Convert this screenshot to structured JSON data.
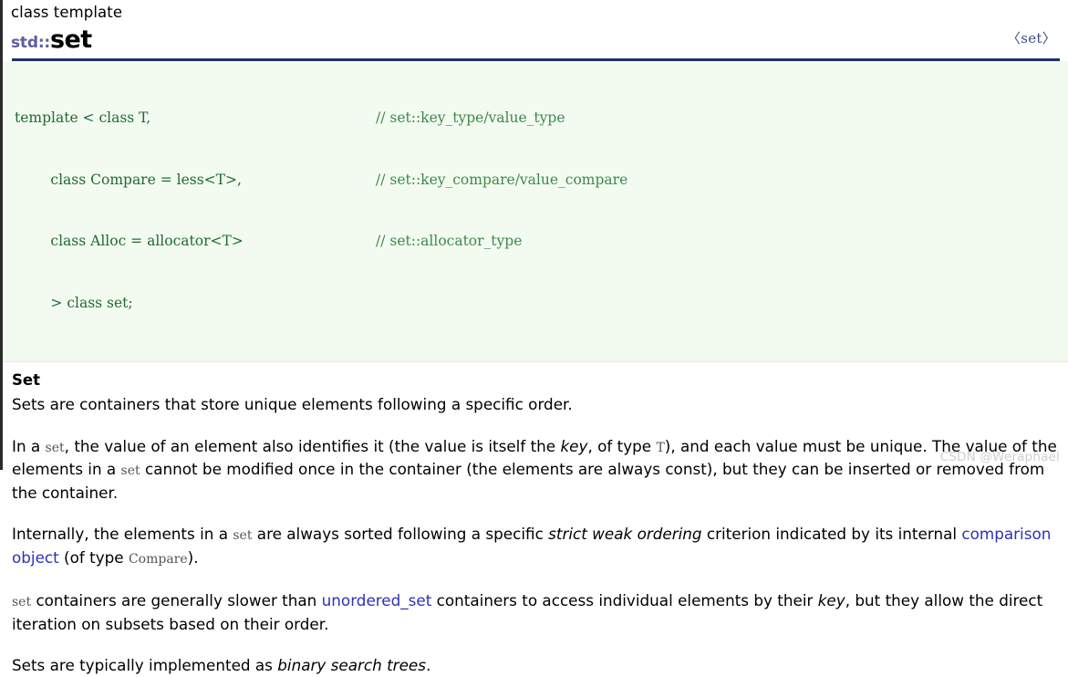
{
  "header": {
    "kind": "class template",
    "namespace": "std::",
    "name": "set",
    "header_file": "〈set〉"
  },
  "code_block": {
    "lines": [
      {
        "code": "template < class T,",
        "comment": "// set::key_type/value_type"
      },
      {
        "code": "        class Compare = less<T>,",
        "comment": "// set::key_compare/value_compare"
      },
      {
        "code": "        class Alloc = allocator<T>",
        "comment": "// set::allocator_type"
      },
      {
        "code": "        > class set;",
        "comment": ""
      }
    ]
  },
  "section": {
    "title": "Set",
    "paragraphs": {
      "p1": "Sets are containers that store unique elements following a specific order.",
      "p2": {
        "t1": "In a ",
        "c1": "set",
        "t2": ", the value of an element also identifies it (the value is itself the ",
        "i1": "key",
        "t3": ", of type ",
        "c2": "T",
        "t4": "), and each value must be unique. The value of the elements in a ",
        "c3": "set",
        "t5": " cannot be modified once in the container (the elements are always const), but they can be inserted or removed from the container."
      },
      "p3": {
        "t1": "Internally, the elements in a ",
        "c1": "set",
        "t2": " are always sorted following a specific ",
        "i1": "strict weak ordering",
        "t3": " criterion indicated by its internal ",
        "link1": "comparison object",
        "t4": " (of type ",
        "c2": "Compare",
        "t5": ")."
      },
      "p4": {
        "c1": "set",
        "t1": " containers are generally slower than ",
        "link1": "unordered_set",
        "t2": " containers to access individual elements by their ",
        "i1": "key",
        "t3": ", but they allow the direct iteration on subsets based on their order."
      },
      "p5": {
        "t1": "Sets are typically implemented as ",
        "i1": "binary search trees",
        "t2": "."
      }
    }
  },
  "watermark": {
    "text": "CSDN @Weraphael"
  },
  "colors": {
    "rule": "#1e3264",
    "namespace": "#5d5d9e",
    "code_text": "#1f6b2f",
    "code_bg": "#f3fbf1",
    "link": "#2b32b8",
    "inline_code": "#555555",
    "watermark": "#cfcfcf"
  }
}
